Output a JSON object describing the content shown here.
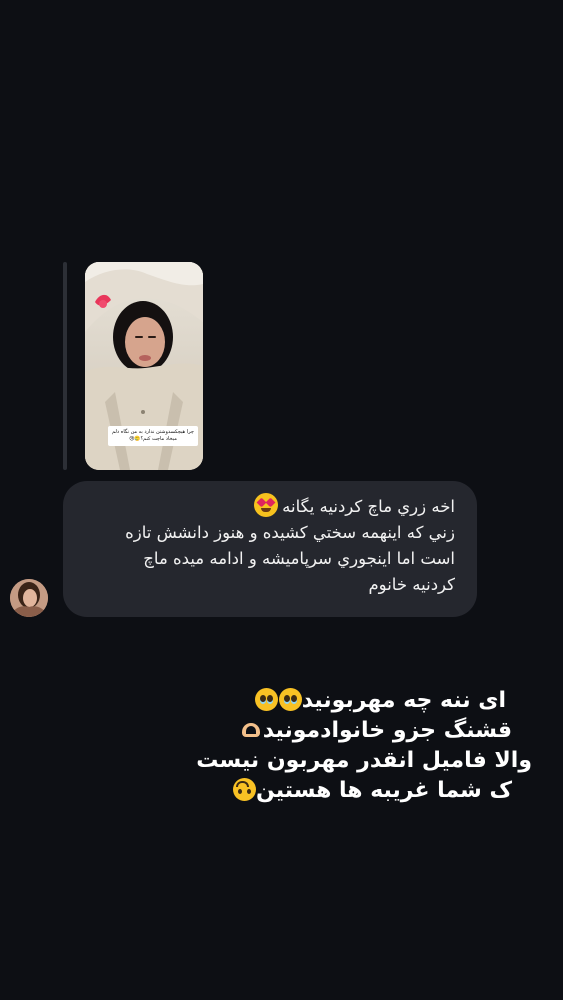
{
  "story_reply": {
    "thumbnail_icon": "story-photo",
    "caption_text": "چرا هیچکسدوشتن ندارد به من نگاه دلم میخاد ماچت کنم؟🥲😢"
  },
  "message": {
    "line_1": "اخه زري ماچ کردنيه يگانه",
    "line_1_emoji": "heart-eyes-emoji",
    "line_2": "زني كه اينهمه سختي كشيده و هنوز دانشش تازه",
    "line_3": "است اما اينجوري سرپاميشه و ادامه ميده ماچ",
    "line_4": "كردنيه خانوم"
  },
  "sender": {
    "avatar_icon": "profile-avatar"
  },
  "overlay_caption": {
    "line_1": "ای ننه چه مهربونید",
    "line_1_emoji": "pleading-face-emoji",
    "line_2": "قشنگ جزو خانوادمونید",
    "line_2_emoji": "heart-hands-emoji",
    "line_3": "والا فامیل انقدر مهربون نیست",
    "line_4": "ک شما غریبه ها هستین",
    "line_4_emoji": "upside-down-face-emoji"
  },
  "colors": {
    "background": "#0d0f14",
    "bubble": "#25272e",
    "reply_bar": "#2c2f36",
    "text": "#ffffff"
  }
}
